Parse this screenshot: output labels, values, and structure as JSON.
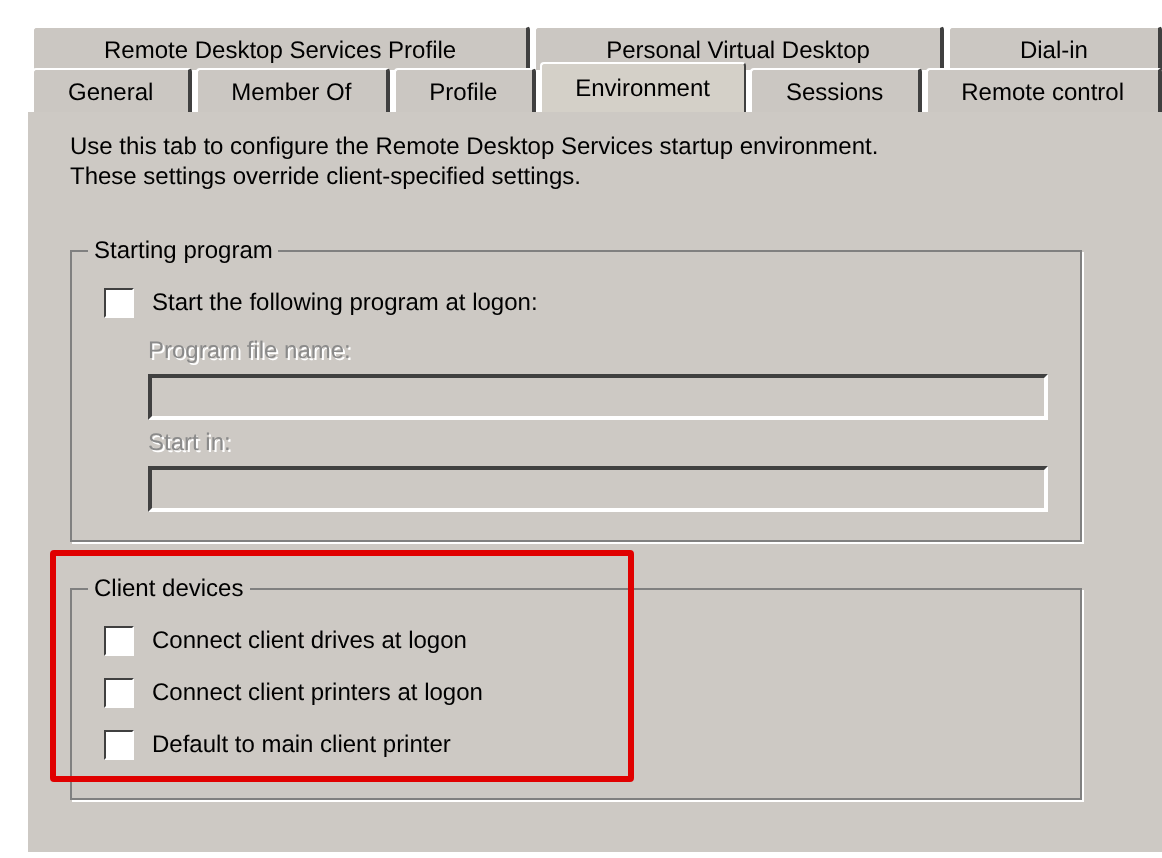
{
  "tab_rows": [
    {
      "tabs": [
        {
          "label": "Remote Desktop Services Profile",
          "selected": false
        },
        {
          "label": "Personal Virtual Desktop",
          "selected": false
        },
        {
          "label": "Dial-in",
          "selected": false
        }
      ]
    },
    {
      "tabs": [
        {
          "label": "General",
          "selected": false
        },
        {
          "label": "Member Of",
          "selected": false
        },
        {
          "label": "Profile",
          "selected": false
        },
        {
          "label": "Environment",
          "selected": true
        },
        {
          "label": "Sessions",
          "selected": false
        },
        {
          "label": "Remote control",
          "selected": false
        }
      ]
    }
  ],
  "description": "Use this tab to configure the Remote Desktop Services startup environment. These settings override client-specified settings.",
  "groups": [
    {
      "title": "Starting program",
      "highlighted": false,
      "items": [
        {
          "kind": "checkbox",
          "label": "Start the following program at logon:",
          "checked": false
        },
        {
          "kind": "field",
          "label": "Program file name:",
          "disabled": true
        },
        {
          "kind": "field",
          "label": "Start in:",
          "disabled": true
        }
      ]
    },
    {
      "title": "Client devices",
      "highlighted": true,
      "items": [
        {
          "kind": "checkbox",
          "label": "Connect client drives at logon",
          "checked": false
        },
        {
          "kind": "checkbox",
          "label": "Connect client printers at logon",
          "checked": false
        },
        {
          "kind": "checkbox",
          "label": "Default to main client printer",
          "checked": false
        }
      ]
    }
  ]
}
